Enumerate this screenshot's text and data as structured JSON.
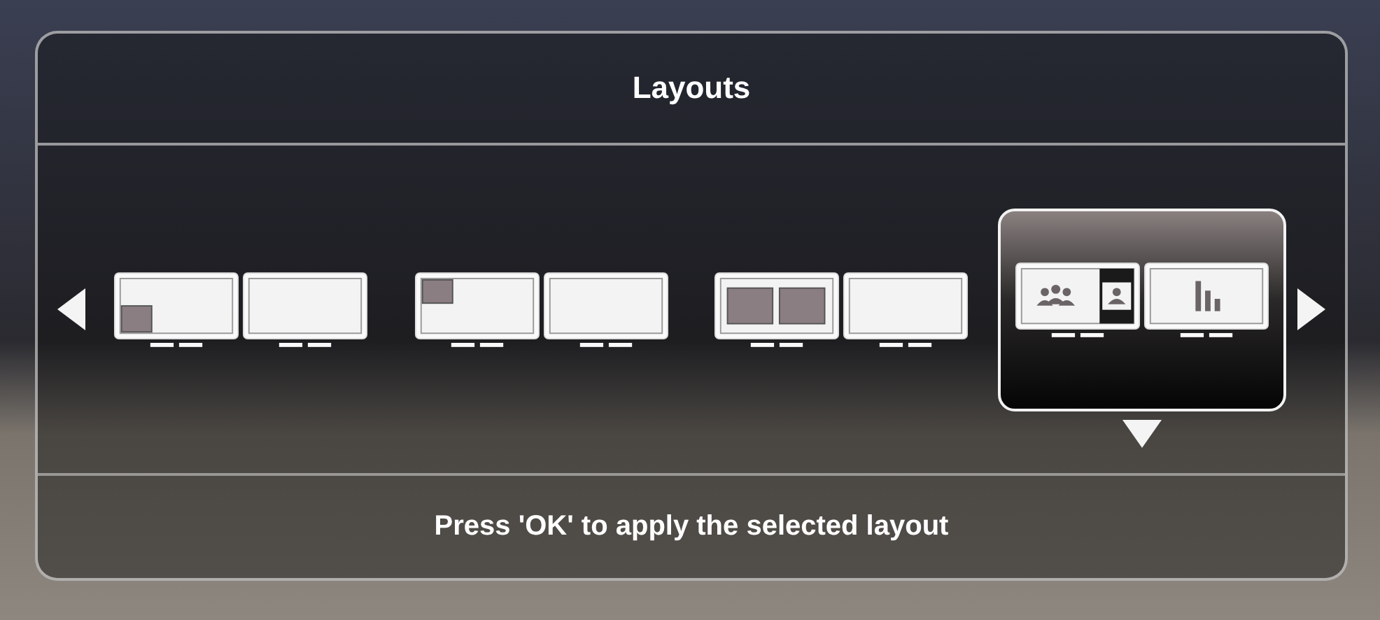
{
  "dialog": {
    "title": "Layouts",
    "layouts": [
      {
        "kind": "pip-bottom-left",
        "selected": false
      },
      {
        "kind": "pip-top-left",
        "selected": false
      },
      {
        "kind": "side-by-side",
        "selected": false
      },
      {
        "kind": "speaker-presentation",
        "selected": true
      }
    ],
    "hint": "Press 'OK' to apply the selected layout"
  }
}
